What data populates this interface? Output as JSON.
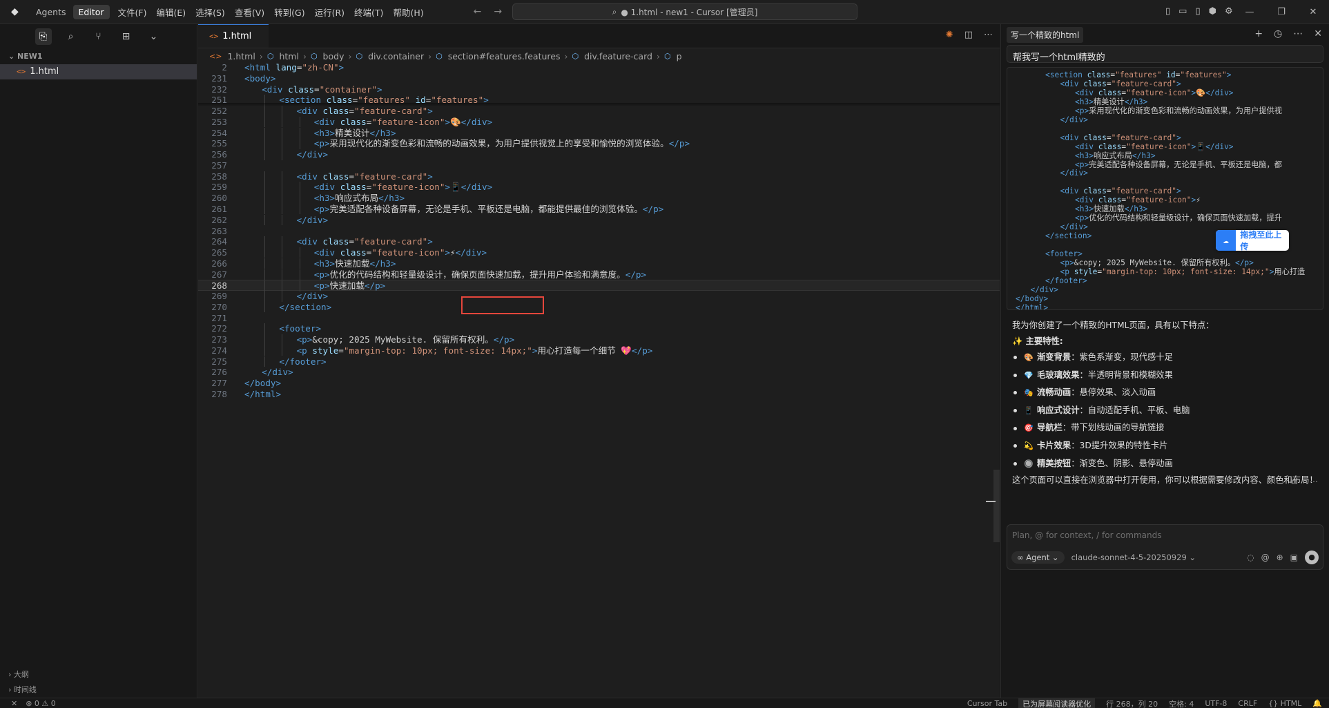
{
  "titlebar": {
    "switch": [
      "Agents",
      "Editor"
    ],
    "menus": [
      "文件(F)",
      "编辑(E)",
      "选择(S)",
      "查看(V)",
      "转到(G)",
      "运行(R)",
      "终端(T)",
      "帮助(H)"
    ],
    "command_center": "● 1.html - new1 - Cursor [管理员]"
  },
  "sidebar": {
    "section": "NEW1",
    "file": "1.html",
    "bottom": [
      "大纲",
      "时间线"
    ]
  },
  "editor": {
    "tab": "1.html",
    "breadcrumb": [
      "1.html",
      "html",
      "body",
      "div.container",
      "section#features.features",
      "div.feature-card",
      "p"
    ],
    "lines": [
      {
        "n": "2",
        "indent": 0,
        "html": "<span class='tg'>&lt;html</span> <span class='at'>lang</span>=<span class='st'>\"zh-CN\"</span><span class='tg'>&gt;</span>"
      },
      {
        "n": "231",
        "indent": 0,
        "html": "<span class='tg'>&lt;body&gt;</span>"
      },
      {
        "n": "232",
        "indent": 1,
        "html": "<span class='tg'>&lt;div</span> <span class='at'>class</span>=<span class='st'>\"container\"</span><span class='tg'>&gt;</span>"
      },
      {
        "n": "251",
        "indent": 2,
        "html": "<span class='tg'>&lt;section</span> <span class='at'>class</span>=<span class='st'>\"features\"</span> <span class='at'>id</span>=<span class='st'>\"features\"</span><span class='tg'>&gt;</span>"
      },
      {
        "n": "252",
        "indent": 3,
        "html": "<span class='tg'>&lt;div</span> <span class='at'>class</span>=<span class='st'>\"feature-card\"</span><span class='tg'>&gt;</span>"
      },
      {
        "n": "253",
        "indent": 4,
        "html": "<span class='tg'>&lt;div</span> <span class='at'>class</span>=<span class='st'>\"feature-icon\"</span><span class='tg'>&gt;</span>🎨<span class='tg'>&lt;/div&gt;</span>"
      },
      {
        "n": "254",
        "indent": 4,
        "html": "<span class='tg'>&lt;h3&gt;</span>精美设计<span class='tg'>&lt;/h3&gt;</span>"
      },
      {
        "n": "255",
        "indent": 4,
        "html": "<span class='tg'>&lt;p&gt;</span>采用现代化的渐变色彩和流畅的动画效果，为用户提供视觉上的享受和愉悦的浏览体验。<span class='tg'>&lt;/p&gt;</span>"
      },
      {
        "n": "256",
        "indent": 3,
        "html": "<span class='tg'>&lt;/div&gt;</span>"
      },
      {
        "n": "257",
        "indent": 0,
        "html": ""
      },
      {
        "n": "258",
        "indent": 3,
        "html": "<span class='tg'>&lt;div</span> <span class='at'>class</span>=<span class='st'>\"feature-card\"</span><span class='tg'>&gt;</span>"
      },
      {
        "n": "259",
        "indent": 4,
        "html": "<span class='tg'>&lt;div</span> <span class='at'>class</span>=<span class='st'>\"feature-icon\"</span><span class='tg'>&gt;</span>📱<span class='tg'>&lt;/div&gt;</span>"
      },
      {
        "n": "260",
        "indent": 4,
        "html": "<span class='tg'>&lt;h3&gt;</span>响应式布局<span class='tg'>&lt;/h3&gt;</span>"
      },
      {
        "n": "261",
        "indent": 4,
        "html": "<span class='tg'>&lt;p&gt;</span>完美适配各种设备屏幕，无论是手机、平板还是电脑，都能提供最佳的浏览体验。<span class='tg'>&lt;/p&gt;</span>"
      },
      {
        "n": "262",
        "indent": 3,
        "html": "<span class='tg'>&lt;/div&gt;</span>"
      },
      {
        "n": "263",
        "indent": 0,
        "html": ""
      },
      {
        "n": "264",
        "indent": 3,
        "html": "<span class='tg'>&lt;div</span> <span class='at'>class</span>=<span class='st'>\"feature-card\"</span><span class='tg'>&gt;</span>"
      },
      {
        "n": "265",
        "indent": 4,
        "html": "<span class='tg'>&lt;div</span> <span class='at'>class</span>=<span class='st'>\"feature-icon\"</span><span class='tg'>&gt;</span>⚡<span class='tg'>&lt;/div&gt;</span>"
      },
      {
        "n": "266",
        "indent": 4,
        "html": "<span class='tg'>&lt;h3&gt;</span>快速加载<span class='tg'>&lt;/h3&gt;</span>"
      },
      {
        "n": "267",
        "indent": 4,
        "html": "<span class='tg'>&lt;p&gt;</span>优化的代码结构和轻量级设计，确保页面快速加载，提升用户体验和满意度。<span class='tg'>&lt;/p&gt;</span>"
      },
      {
        "n": "268",
        "indent": 4,
        "html": "<span class='tg'>&lt;p&gt;</span><span class='pl'>快速加载</span><span class='tg'>&lt;/p&gt;</span>",
        "current": true
      },
      {
        "n": "269",
        "indent": 3,
        "html": "<span class='tg'>&lt;/div&gt;</span>"
      },
      {
        "n": "270",
        "indent": 2,
        "html": "<span class='tg'>&lt;/section&gt;</span>"
      },
      {
        "n": "271",
        "indent": 0,
        "html": ""
      },
      {
        "n": "272",
        "indent": 2,
        "html": "<span class='tg'>&lt;footer&gt;</span>"
      },
      {
        "n": "273",
        "indent": 3,
        "html": "<span class='tg'>&lt;p&gt;</span>&amp;copy; 2025 MyWebsite. 保留所有权利。<span class='tg'>&lt;/p&gt;</span>"
      },
      {
        "n": "274",
        "indent": 3,
        "html": "<span class='tg'>&lt;p</span> <span class='at'>style</span>=<span class='st'>\"margin-top: 10px; font-size: 14px;\"</span><span class='tg'>&gt;</span>用心打造每一个细节 💖<span class='tg'>&lt;/p&gt;</span>"
      },
      {
        "n": "275",
        "indent": 2,
        "html": "<span class='tg'>&lt;/footer&gt;</span>"
      },
      {
        "n": "276",
        "indent": 1,
        "html": "<span class='tg'>&lt;/div&gt;</span>"
      },
      {
        "n": "277",
        "indent": 0,
        "html": "<span class='tg'>&lt;/body&gt;</span>"
      },
      {
        "n": "278",
        "indent": 0,
        "html": "<span class='tg'>&lt;/html&gt;</span>"
      }
    ]
  },
  "chat": {
    "tab": "写一个精致的html",
    "user_message": "帮我写一个html精致的",
    "code_lines": [
      {
        "indent": 2,
        "html": "<span class='tg'>&lt;section</span> <span class='at'>class</span>=<span class='st'>\"features\"</span> <span class='at'>id</span>=<span class='st'>\"features\"</span><span class='tg'>&gt;</span>"
      },
      {
        "indent": 3,
        "html": "<span class='tg'>&lt;div</span> <span class='at'>class</span>=<span class='st'>\"feature-card\"</span><span class='tg'>&gt;</span>"
      },
      {
        "indent": 4,
        "html": "<span class='tg'>&lt;div</span> <span class='at'>class</span>=<span class='st'>\"feature-icon\"</span><span class='tg'>&gt;</span>🎨<span class='tg'>&lt;/div&gt;</span>"
      },
      {
        "indent": 4,
        "html": "<span class='tg'>&lt;h3&gt;</span>精美设计<span class='tg'>&lt;/h3&gt;</span>"
      },
      {
        "indent": 4,
        "html": "<span class='tg'>&lt;p&gt;</span>采用现代化的渐变色彩和流畅的动画效果，为用户提供视"
      },
      {
        "indent": 3,
        "html": "<span class='tg'>&lt;/div&gt;</span>"
      },
      {
        "indent": 0,
        "html": ""
      },
      {
        "indent": 3,
        "html": "<span class='tg'>&lt;div</span> <span class='at'>class</span>=<span class='st'>\"feature-card\"</span><span class='tg'>&gt;</span>"
      },
      {
        "indent": 4,
        "html": "<span class='tg'>&lt;div</span> <span class='at'>class</span>=<span class='st'>\"feature-icon\"</span><span class='tg'>&gt;</span>📱<span class='tg'>&lt;/div&gt;</span>"
      },
      {
        "indent": 4,
        "html": "<span class='tg'>&lt;h3&gt;</span>响应式布局<span class='tg'>&lt;/h3&gt;</span>"
      },
      {
        "indent": 4,
        "html": "<span class='tg'>&lt;p&gt;</span>完美适配各种设备屏幕，无论是手机、平板还是电脑，都"
      },
      {
        "indent": 3,
        "html": "<span class='tg'>&lt;/div&gt;</span>"
      },
      {
        "indent": 0,
        "html": ""
      },
      {
        "indent": 3,
        "html": "<span class='tg'>&lt;div</span> <span class='at'>class</span>=<span class='st'>\"feature-card\"</span><span class='tg'>&gt;</span>"
      },
      {
        "indent": 4,
        "html": "<span class='tg'>&lt;div</span> <span class='at'>class</span>=<span class='st'>\"feature-icon\"</span><span class='tg'>&gt;</span>⚡"
      },
      {
        "indent": 4,
        "html": "<span class='tg'>&lt;h3&gt;</span>快速加载<span class='tg'>&lt;/h3&gt;</span>"
      },
      {
        "indent": 4,
        "html": "<span class='tg'>&lt;p&gt;</span>优化的代码结构和轻量级设计，确保页面快速加载，提升"
      },
      {
        "indent": 3,
        "html": "<span class='tg'>&lt;/div&gt;</span>"
      },
      {
        "indent": 2,
        "html": "<span class='tg'>&lt;/section&gt;</span>"
      },
      {
        "indent": 0,
        "html": ""
      },
      {
        "indent": 2,
        "html": "<span class='tg'>&lt;footer&gt;</span>"
      },
      {
        "indent": 3,
        "html": "<span class='tg'>&lt;p&gt;</span>&amp;copy; 2025 MyWebsite. 保留所有权利。<span class='tg'>&lt;/p&gt;</span>"
      },
      {
        "indent": 3,
        "html": "<span class='tg'>&lt;p</span> <span class='at'>style</span>=<span class='st'>\"margin-top: 10px; font-size: 14px;\"</span><span class='tg'>&gt;</span>用心打造"
      },
      {
        "indent": 2,
        "html": "<span class='tg'>&lt;/footer&gt;</span>"
      },
      {
        "indent": 1,
        "html": "<span class='tg'>&lt;/div&gt;</span>"
      },
      {
        "indent": 0,
        "html": "<span class='tg'>&lt;/body&gt;</span>"
      },
      {
        "indent": 0,
        "html": "<span class='tg'>&lt;/html&gt;</span>"
      }
    ],
    "upload_label": "拖拽至此上传",
    "intro": "我为你创建了一个精致的HTML页面，具有以下特点：",
    "features_heading": "✨ 主要特性:",
    "features": [
      {
        "icon": "🎨",
        "title": "渐变背景",
        "desc": "：紫色系渐变，现代感十足"
      },
      {
        "icon": "💎",
        "title": "毛玻璃效果",
        "desc": "：半透明背景和模糊效果"
      },
      {
        "icon": "🎭",
        "title": "流畅动画",
        "desc": "：悬停效果、淡入动画"
      },
      {
        "icon": "📱",
        "title": "响应式设计",
        "desc": "：自动适配手机、平板、电脑"
      },
      {
        "icon": "🎯",
        "title": "导航栏",
        "desc": "：带下划线动画的导航链接"
      },
      {
        "icon": "💫",
        "title": "卡片效果",
        "desc": "：3D提升效果的特性卡片"
      },
      {
        "icon": "🔘",
        "title": "精美按钮",
        "desc": "：渐变色、阴影、悬停动画"
      }
    ],
    "closing": "这个页面可以直接在浏览器中打开使用，你可以根据需要修改内容、颜色和布局！",
    "composer_placeholder": "Plan, @ for context, / for commands",
    "agent_label": "∞ Agent ⌄",
    "model": "claude-sonnet-4-5-20250929 ⌄"
  },
  "statusbar": {
    "left": [
      "⊗ 0 ⚠ 0"
    ],
    "right": [
      "Cursor Tab",
      "已为屏幕阅读器优化",
      "行 268，列 20",
      "空格: 4",
      "UTF-8",
      "CRLF",
      "{} HTML",
      "🔔"
    ]
  }
}
